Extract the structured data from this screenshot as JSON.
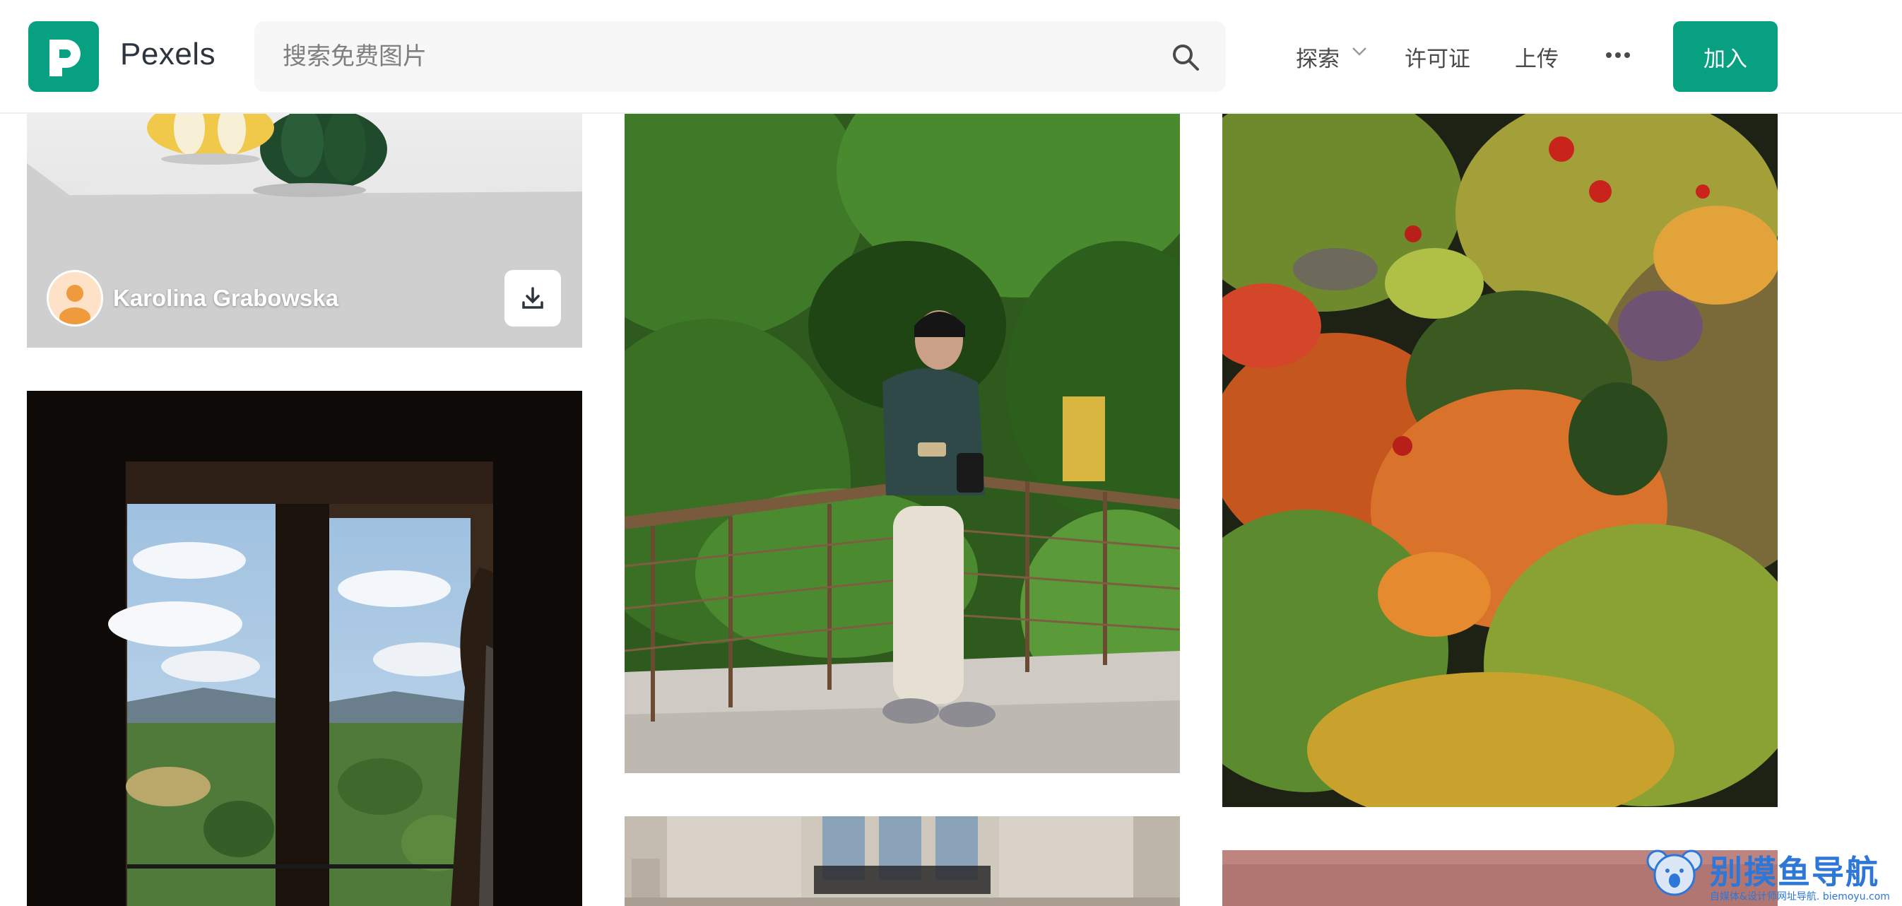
{
  "app": {
    "brand": "Pexels"
  },
  "search": {
    "placeholder": "搜索免费图片"
  },
  "nav": {
    "explore": "探索",
    "license": "许可证",
    "upload": "上传",
    "join": "加入"
  },
  "photos": [
    {
      "author": "Karolina Grabowska"
    }
  ],
  "watermark": {
    "title": "别摸鱼导航",
    "subtitle": "自媒体&设计师网址导航. biemoyu.com"
  },
  "colors": {
    "accent": "#07a081",
    "watermark": "#2d77d8"
  },
  "icons": [
    "pexels-logo-icon",
    "search-icon",
    "chevron-down-icon",
    "more-icon",
    "download-icon",
    "avatar-icon"
  ]
}
